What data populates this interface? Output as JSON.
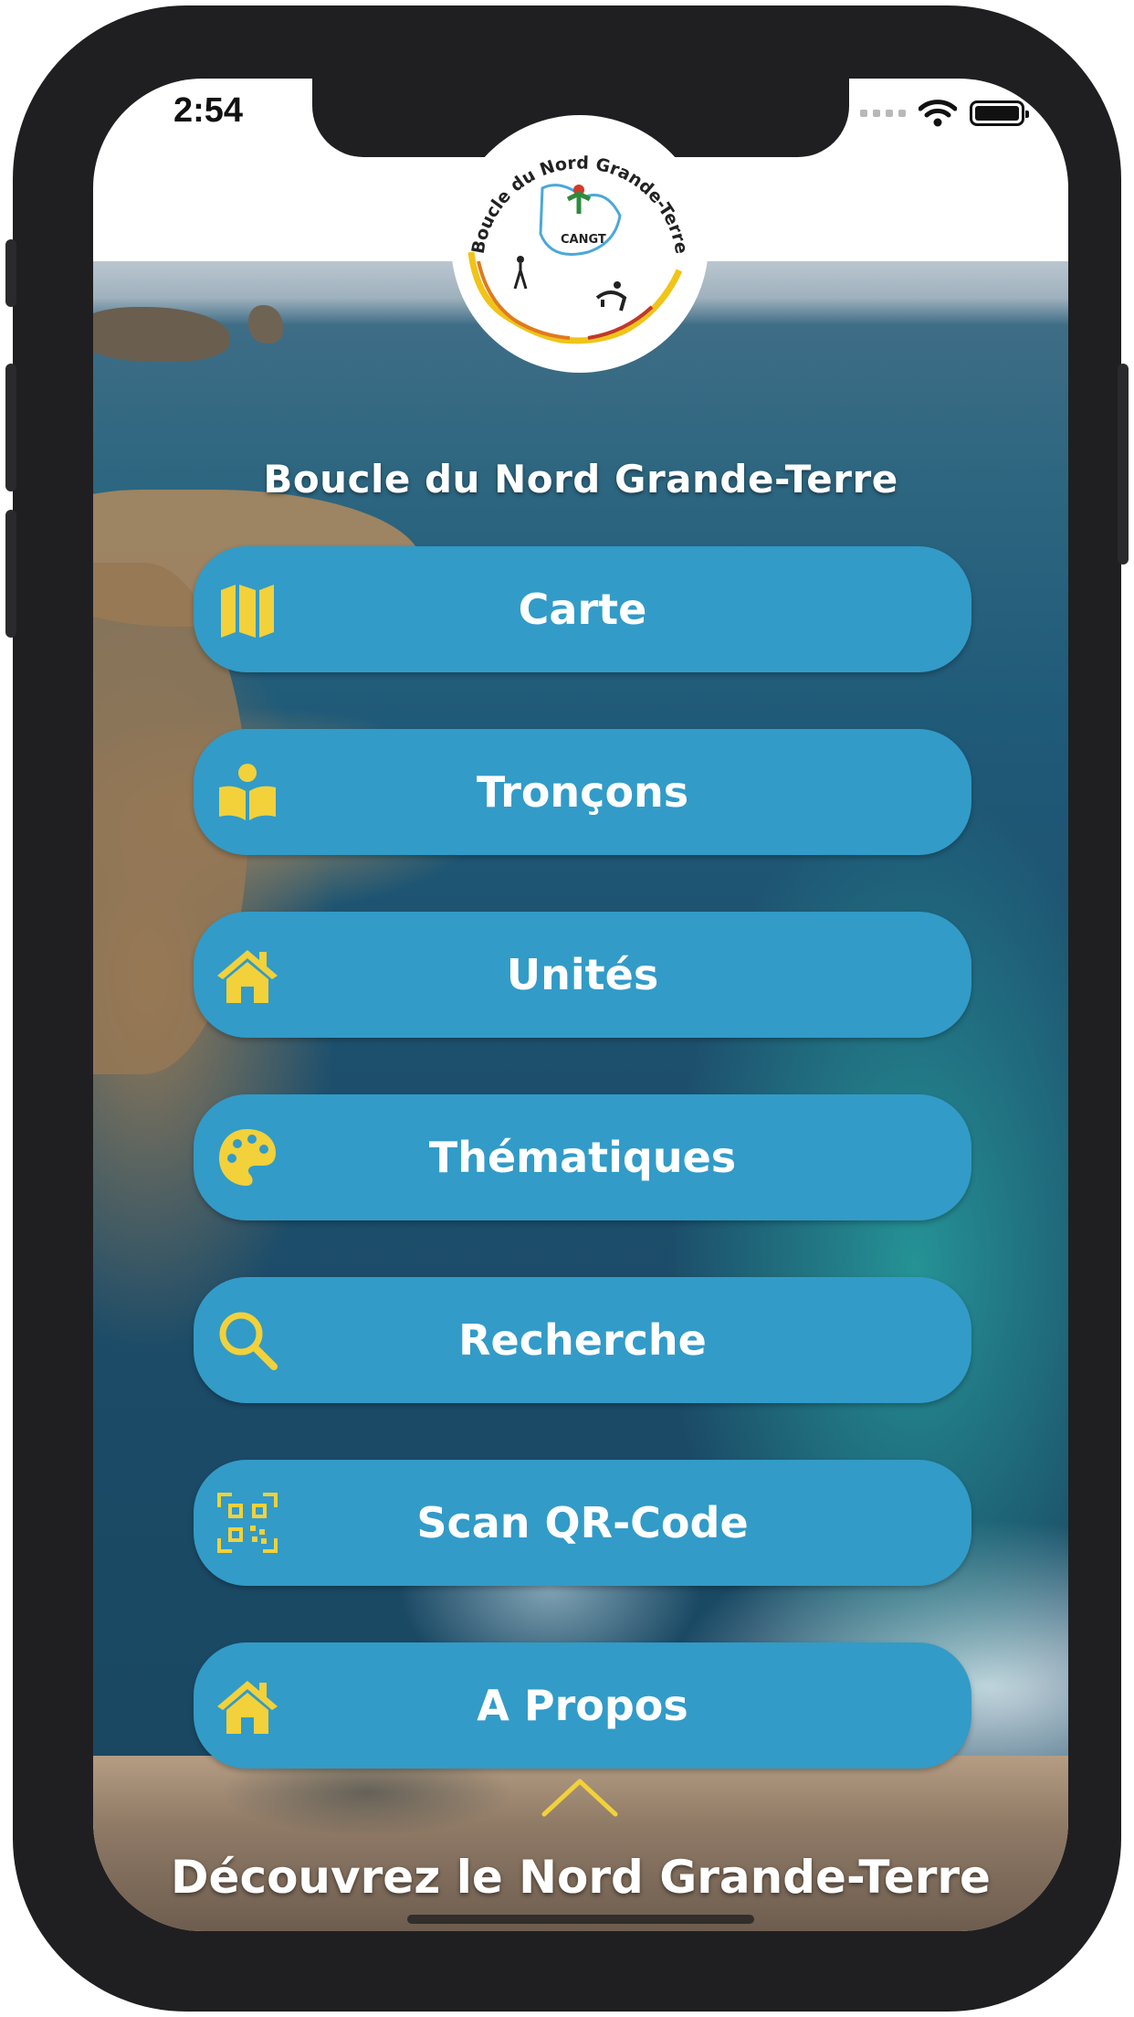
{
  "status_bar": {
    "time": "2:54"
  },
  "logo": {
    "arc_text": "- Boucle du Nord Grande-Terre -",
    "badge": "CANGT"
  },
  "app_title": "Boucle du Nord Grande-Terre",
  "menu": [
    {
      "label": "Carte",
      "icon": "map-icon"
    },
    {
      "label": "Tronçons",
      "icon": "book-reader-icon"
    },
    {
      "label": "Unités",
      "icon": "home-icon"
    },
    {
      "label": "Thématiques",
      "icon": "palette-icon"
    },
    {
      "label": "Recherche",
      "icon": "search-icon"
    },
    {
      "label": "Scan QR-Code",
      "icon": "qrcode-icon"
    },
    {
      "label": "A Propos",
      "icon": "home-icon"
    }
  ],
  "footer": {
    "text": "Découvrez le Nord Grande-Terre"
  },
  "colors": {
    "button": "#329bc8",
    "icon": "#f2d13a",
    "frame": "#1f1f21"
  }
}
